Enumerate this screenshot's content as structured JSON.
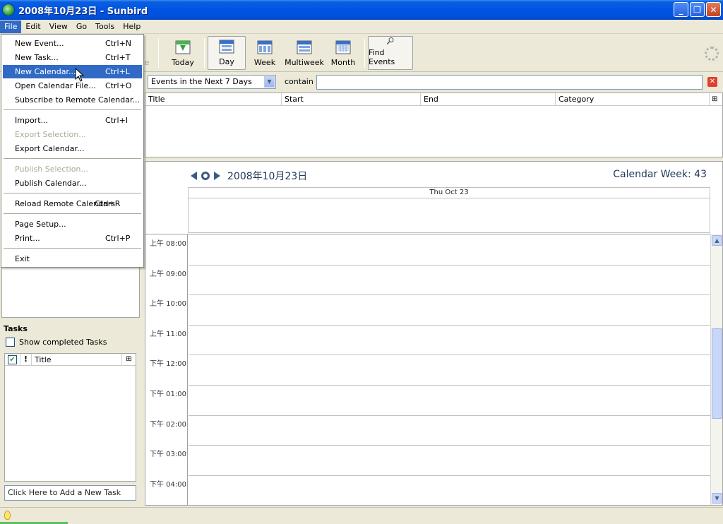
{
  "window": {
    "title": "2008年10月23日 - Sunbird"
  },
  "menubar": {
    "file": "File",
    "edit": "Edit",
    "view": "View",
    "go": "Go",
    "tools": "Tools",
    "help": "Help"
  },
  "toolbar": {
    "truncated": "te",
    "today": "Today",
    "day": "Day",
    "week": "Week",
    "multiweek": "Multiweek",
    "month": "Month",
    "find_events": "Find Events"
  },
  "filemenu": {
    "items": [
      {
        "label": "New Event...",
        "shortcut": "Ctrl+N"
      },
      {
        "label": "New Task...",
        "shortcut": "Ctrl+T"
      },
      {
        "label": "New Calendar...",
        "shortcut": "Ctrl+L"
      },
      {
        "label": "Open Calendar File...",
        "shortcut": "Ctrl+O"
      },
      {
        "label": "Subscribe to Remote Calendar...",
        "shortcut": ""
      },
      {
        "label": "Import...",
        "shortcut": "Ctrl+I"
      },
      {
        "label": "Export Selection...",
        "shortcut": ""
      },
      {
        "label": "Export Calendar...",
        "shortcut": ""
      },
      {
        "label": "Publish Selection...",
        "shortcut": ""
      },
      {
        "label": "Publish Calendar...",
        "shortcut": ""
      },
      {
        "label": "Reload Remote Calendars",
        "shortcut": "Ctrl+R"
      },
      {
        "label": "Page Setup...",
        "shortcut": ""
      },
      {
        "label": "Print...",
        "shortcut": "Ctrl+P"
      },
      {
        "label": "Exit",
        "shortcut": ""
      }
    ]
  },
  "tasks": {
    "heading": "Tasks",
    "show_completed": "Show completed Tasks",
    "col_priority": "!",
    "col_title": "Title",
    "add_placeholder": "Click Here to Add a New Task"
  },
  "filter": {
    "selected": "Events in the Next 7 Days",
    "contain_label": "contain"
  },
  "eventlist": {
    "columns": [
      "Title",
      "Start",
      "End",
      "Category"
    ]
  },
  "dayview": {
    "date": "2008年10月23日",
    "week_label": "Calendar Week: 43",
    "day_header": "Thu Oct 23",
    "hours": [
      "上午 08:00",
      "上午 09:00",
      "上午 10:00",
      "上午 11:00",
      "下午 12:00",
      "下午 01:00",
      "下午 02:00",
      "下午 03:00",
      "下午 04:00"
    ]
  },
  "colors": {
    "titlebar": "#0054e3",
    "highlight": "#316ac5",
    "nav": "#3b5b86"
  }
}
